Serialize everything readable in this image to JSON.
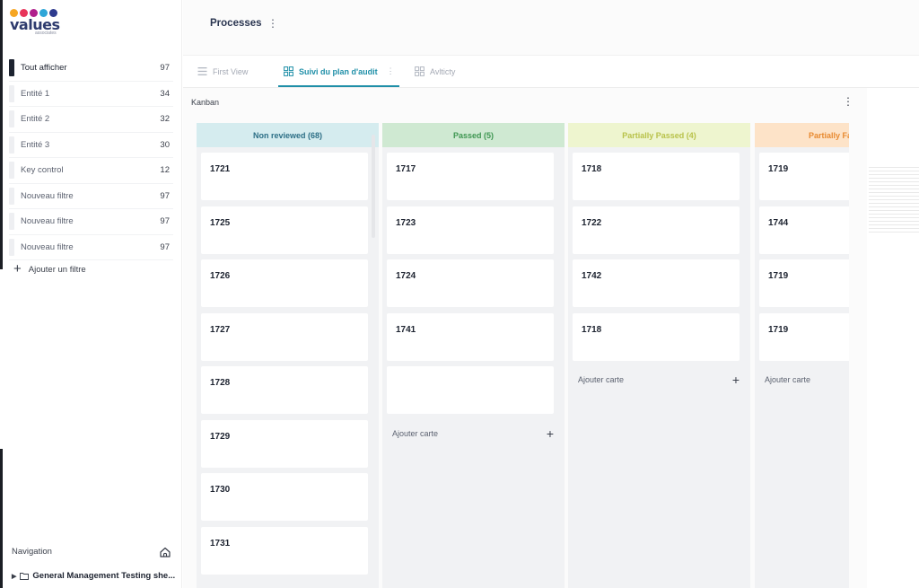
{
  "logo": {
    "word": "values",
    "sub": "associates",
    "dot_colors": [
      "#f6a623",
      "#e8345a",
      "#b0208c",
      "#2fa6d8",
      "#2e3b8e"
    ]
  },
  "sidebar": {
    "filters": [
      {
        "label": "Tout afficher",
        "count": "97",
        "active": true
      },
      {
        "label": "Entité 1",
        "count": "34"
      },
      {
        "label": "Entité 2",
        "count": "32"
      },
      {
        "label": "Entité 3",
        "count": "30"
      },
      {
        "label": "Key control",
        "count": "12"
      },
      {
        "label": "Nouveau filtre",
        "count": "97"
      },
      {
        "label": "Nouveau filtre",
        "count": "97"
      },
      {
        "label": "Nouveau filtre",
        "count": "97"
      }
    ],
    "add_filter": "Ajouter un filtre",
    "navigation_title": "Navigation",
    "tree_item": "General Management Testing she..."
  },
  "header": {
    "title": "Processes"
  },
  "tabs": [
    {
      "label": "First View",
      "icon": "list-icon"
    },
    {
      "label": "Suivi du plan d'audit",
      "icon": "kanban-icon",
      "active": true
    },
    {
      "label": "Avlticty",
      "icon": "kanban-icon"
    }
  ],
  "kanban": {
    "title": "Kanban",
    "add_card_label": "Ajouter carte",
    "columns": [
      {
        "title": "Non reviewed (68)",
        "bg": "#d5ecef",
        "color": "#2d6f86",
        "cards": [
          "1721",
          "1725",
          "1726",
          "1727",
          "1728",
          "1729",
          "1730",
          "1731"
        ],
        "add": false
      },
      {
        "title": "Passed (5)",
        "bg": "#cfe9d2",
        "color": "#3e9651",
        "cards": [
          "1717",
          "1723",
          "1724",
          "1741",
          ""
        ],
        "add": true
      },
      {
        "title": "Partially Passed (4)",
        "bg": "#eef5cf",
        "color": "#b8c24a",
        "cards": [
          "1718",
          "1722",
          "1742",
          "1718"
        ],
        "add": true
      },
      {
        "title": "Partially Fa",
        "bg": "#fde3c8",
        "color": "#e88a30",
        "cards": [
          "1719",
          "1744",
          "1719",
          "1719"
        ],
        "add": true
      }
    ]
  }
}
